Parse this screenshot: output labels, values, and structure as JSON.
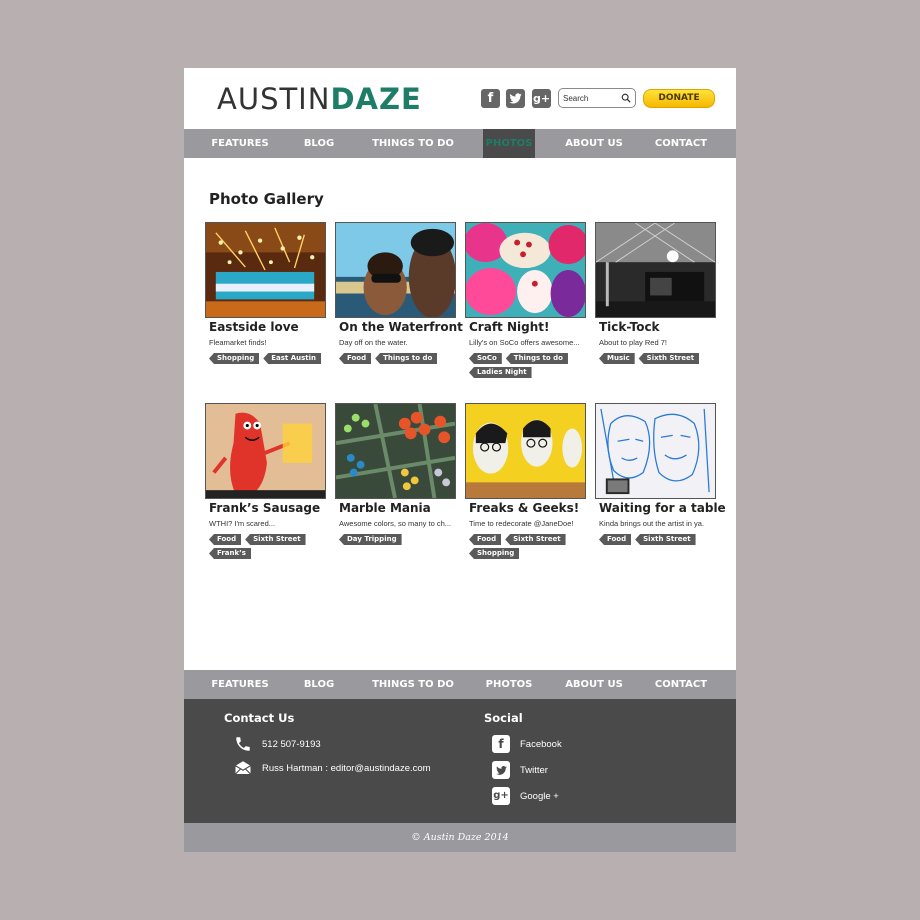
{
  "header": {
    "logo_part1": "AUSTIN",
    "logo_part2": "DAZE",
    "social_icons": [
      "facebook-icon",
      "twitter-icon",
      "google-plus-icon"
    ],
    "search_placeholder": "Search",
    "donate_label": "DONATE"
  },
  "nav": {
    "items": [
      "FEATURES",
      "BLOG",
      "THINGS TO DO",
      "PHOTOS",
      "ABOUT US",
      "CONTACT"
    ],
    "active": "PHOTOS"
  },
  "gallery": {
    "title": "Photo Gallery",
    "photos": [
      {
        "title": "Eastside love",
        "desc": "Fleamarket finds!",
        "tags": [
          "Shopping",
          "East Austin"
        ]
      },
      {
        "title": "On the Waterfront",
        "desc": "Day off on the water.",
        "tags": [
          "Food",
          "Things to do"
        ]
      },
      {
        "title": "Craft Night!",
        "desc": "Lilly's on SoCo offers awesome...",
        "tags": [
          "SoCo",
          "Things to do",
          "Ladies Night"
        ]
      },
      {
        "title": "Tick-Tock",
        "desc": "About to play Red 7!",
        "tags": [
          "Music",
          "Sixth Street"
        ]
      },
      {
        "title": "Frank’s Sausage",
        "desc": "WTHI? I'm scared...",
        "tags": [
          "Food",
          "Sixth Street",
          "Frank’s"
        ]
      },
      {
        "title": "Marble Mania",
        "desc": "Awesome colors, so many to ch...",
        "tags": [
          "Day Tripping"
        ]
      },
      {
        "title": "Freaks & Geeks!",
        "desc": "Time to redecorate @JaneDoe!",
        "tags": [
          "Food",
          "Sixth Street",
          "Shopping"
        ]
      },
      {
        "title": "Waiting for a table",
        "desc": "Kinda brings out the artist in ya.",
        "tags": [
          "Food",
          "Sixth Street"
        ]
      }
    ]
  },
  "footer": {
    "contact_heading": "Contact Us",
    "phone": "512 507-9193",
    "email": "Russ Hartman : editor@austindaze.com",
    "social_heading": "Social",
    "social_links": [
      "Facebook",
      "Twitter",
      "Google +"
    ],
    "copyright": "© Austin Daze 2014"
  },
  "colors": {
    "background": "#b8b0b0",
    "brand_green": "#1e7d66",
    "nav_gray": "#9a9a9e",
    "footer_dark": "#4a4a4a",
    "donate_yellow": "#f6c400"
  }
}
